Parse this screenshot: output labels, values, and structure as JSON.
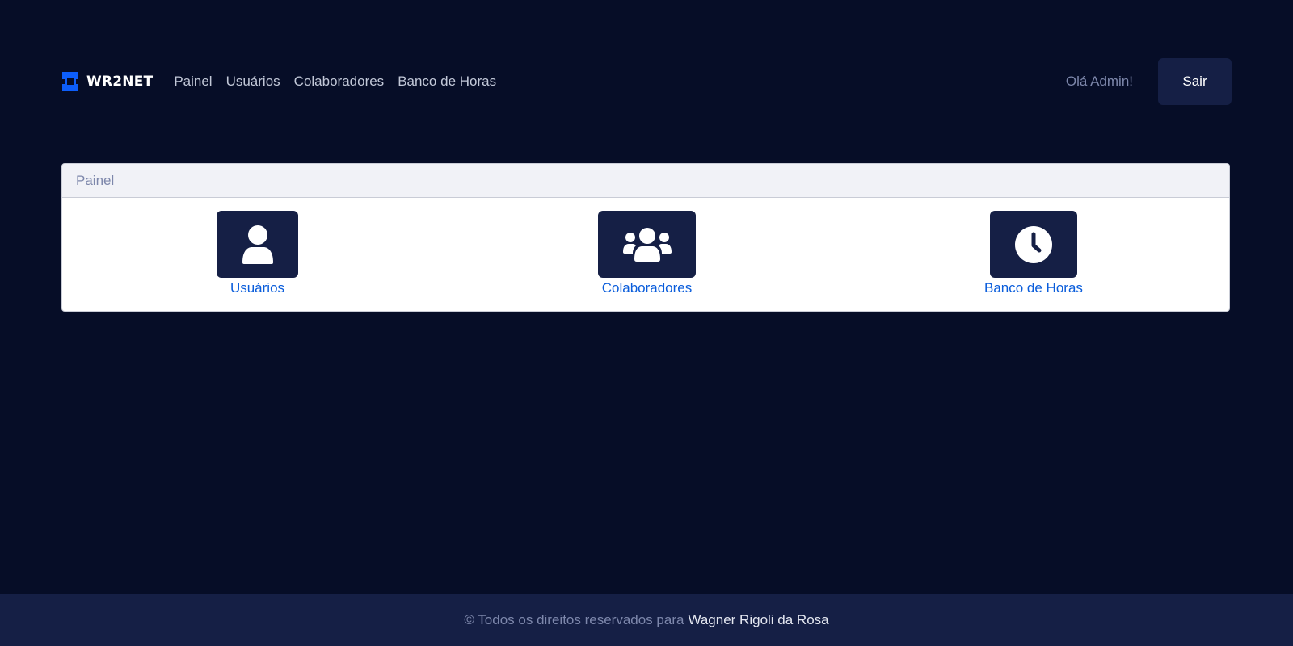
{
  "navbar": {
    "brand": {
      "name": "WR2NET",
      "logo_icon": "wr2net-logo-icon",
      "logo_color": "#0d5efa"
    },
    "links": [
      {
        "label": "Painel"
      },
      {
        "label": "Usuários"
      },
      {
        "label": "Colaboradores"
      },
      {
        "label": "Banco de Horas"
      }
    ],
    "greeting": "Olá Admin!",
    "logout_label": "Sair"
  },
  "panel": {
    "header": "Painel",
    "tiles": [
      {
        "label": "Usuários",
        "icon": "user-icon"
      },
      {
        "label": "Colaboradores",
        "icon": "users-group-icon"
      },
      {
        "label": "Banco de Horas",
        "icon": "clock-icon"
      }
    ]
  },
  "footer": {
    "text": "© Todos os direitos reservados para",
    "author": "Wagner Rigoli da Rosa"
  },
  "colors": {
    "background": "#060d27",
    "surface": "#151f45",
    "accent": "#0a5ddb",
    "muted_text": "#7d87ab",
    "card_bg": "#ffffff",
    "card_header_bg": "#f1f2f7"
  }
}
